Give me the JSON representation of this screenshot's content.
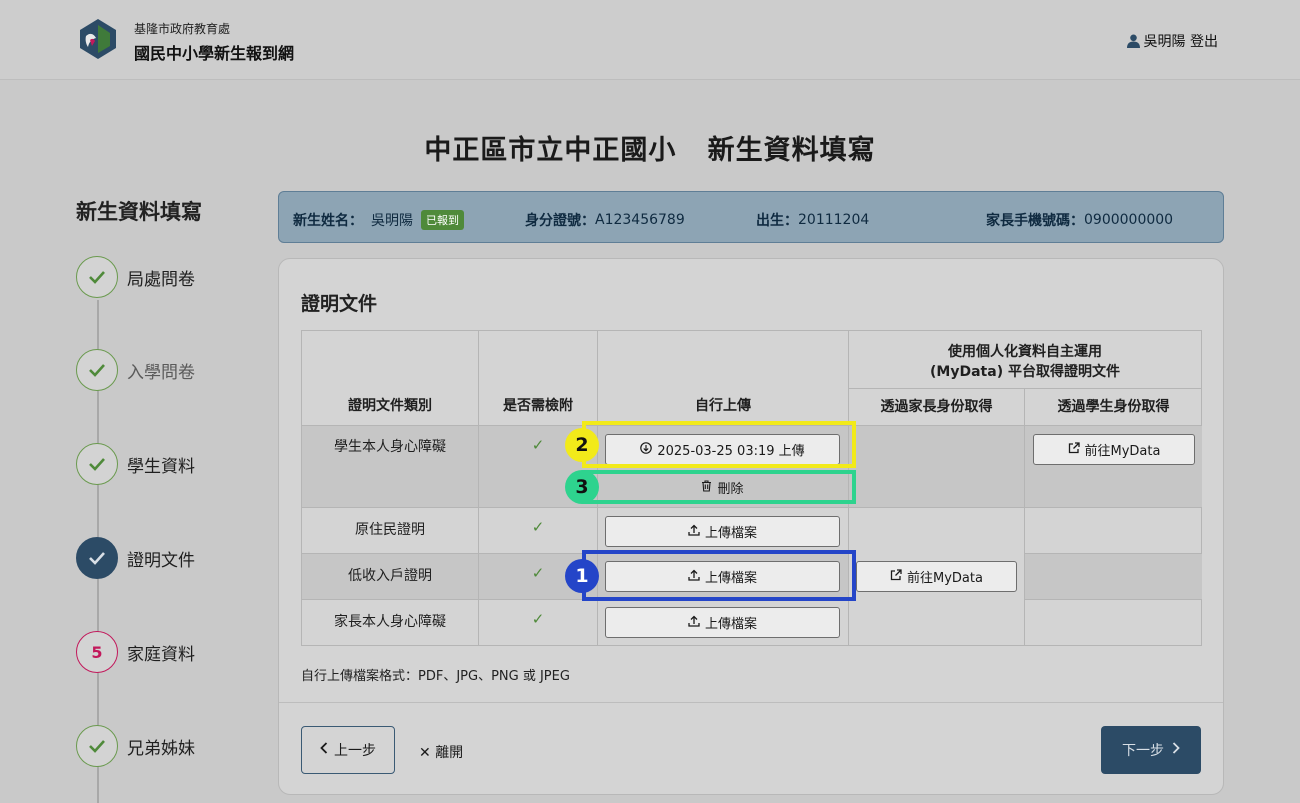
{
  "header": {
    "org": "基隆市政府教育處",
    "site_title": "國民中小學新生報到網",
    "user": "吳明陽 登出"
  },
  "page_title": "中正區市立中正國小   新生資料填寫",
  "sidebar": {
    "title": "新生資料填寫",
    "steps": [
      {
        "label": "局處問卷",
        "status": "done"
      },
      {
        "label": "入學問卷",
        "status": "done"
      },
      {
        "label": "學生資料",
        "status": "done"
      },
      {
        "label": "證明文件",
        "status": "current"
      },
      {
        "label": "家庭資料",
        "status": "pending",
        "number": "5"
      },
      {
        "label": "兄弟姊妹",
        "status": "done"
      }
    ]
  },
  "student_info": {
    "name_label": "新生姓名：",
    "name": "吳明陽",
    "badge": "已報到",
    "id_label": "身分證號：",
    "id": "A123456789",
    "birth_label": "出生：",
    "birth": "20111204",
    "phone_label": "家長手機號碼：",
    "phone": "0900000000"
  },
  "documents": {
    "title": "證明文件",
    "headers": {
      "type": "證明文件類別",
      "required": "是否需檢附",
      "upload": "自行上傳",
      "mydata_line1": "使用個人化資料自主運用",
      "mydata_line2": "(MyData) 平台取得證明文件",
      "via_parent": "透過家長身份取得",
      "via_student": "透過學生身份取得"
    },
    "rows": [
      {
        "type": "學生本人身心障礙",
        "required": "✓",
        "uploaded": "2025-03-25 03:19 上傳",
        "delete": "刪除",
        "student_mydata": "前往MyData"
      },
      {
        "type": "原住民證明",
        "required": "✓",
        "upload": "上傳檔案"
      },
      {
        "type": "低收入戶證明",
        "required": "✓",
        "upload": "上傳檔案",
        "parent_mydata": "前往MyData"
      },
      {
        "type": "家長本人身心障礙",
        "required": "✓",
        "upload": "上傳檔案"
      }
    ],
    "format_note": "自行上傳檔案格式：PDF、JPG、PNG 或 JPEG"
  },
  "annotations": [
    {
      "number": "1",
      "color": "#2445c8"
    },
    {
      "number": "2",
      "color": "#f2ea1a"
    },
    {
      "number": "3",
      "color": "#2ed38e"
    }
  ],
  "nav": {
    "prev": "上一步",
    "leave": "離開",
    "next": "下一步"
  },
  "colors": {
    "accent_dark": "#2c4b66",
    "check_green": "#4f8a3a",
    "pending_red": "#c2185b"
  }
}
